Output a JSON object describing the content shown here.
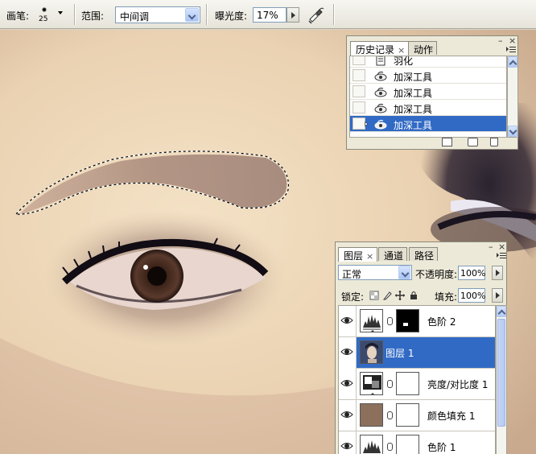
{
  "options_bar": {
    "brush_label": "画笔:",
    "brush_size": "25",
    "range_label": "范围:",
    "range_value": "中间调",
    "exposure_label": "曝光度:",
    "exposure_value": "17%"
  },
  "history_panel": {
    "tabs": [
      {
        "label": "历史记录",
        "close": "×"
      },
      {
        "label": "动作"
      }
    ],
    "items": [
      {
        "label": "羽化",
        "icon": "feather-step-icon",
        "selected": false
      },
      {
        "label": "加深工具",
        "icon": "burn-tool-icon",
        "selected": false
      },
      {
        "label": "加深工具",
        "icon": "burn-tool-icon",
        "selected": false
      },
      {
        "label": "加深工具",
        "icon": "burn-tool-icon",
        "selected": false
      },
      {
        "label": "加深工具",
        "icon": "burn-tool-icon",
        "selected": true
      }
    ]
  },
  "layers_panel": {
    "tabs": [
      {
        "label": "图层",
        "close": "×"
      },
      {
        "label": "通道"
      },
      {
        "label": "路径"
      }
    ],
    "blend_mode": "正常",
    "opacity_label": "不透明度:",
    "opacity_value": "100%",
    "lock_label": "锁定:",
    "fill_label": "填充:",
    "fill_value": "100%",
    "layers": [
      {
        "name": "色阶 2",
        "kind": "adjustment",
        "mask": "black-with-white-spot",
        "selected": false
      },
      {
        "name": "图层 1",
        "kind": "pixel",
        "selected": true
      },
      {
        "name": "亮度/对比度 1",
        "kind": "adjustment",
        "mask": "white",
        "selected": false
      },
      {
        "name": "颜色填充 1",
        "kind": "fill",
        "fill_color": "#8c705c",
        "mask": "white",
        "selected": false
      },
      {
        "name": "色阶 1",
        "kind": "adjustment",
        "mask": "white",
        "selected": false
      }
    ]
  },
  "colors": {
    "selection_blue": "#316ac5",
    "panel_bg": "#ece9d8",
    "fill_layer_color": "#8c705c"
  }
}
